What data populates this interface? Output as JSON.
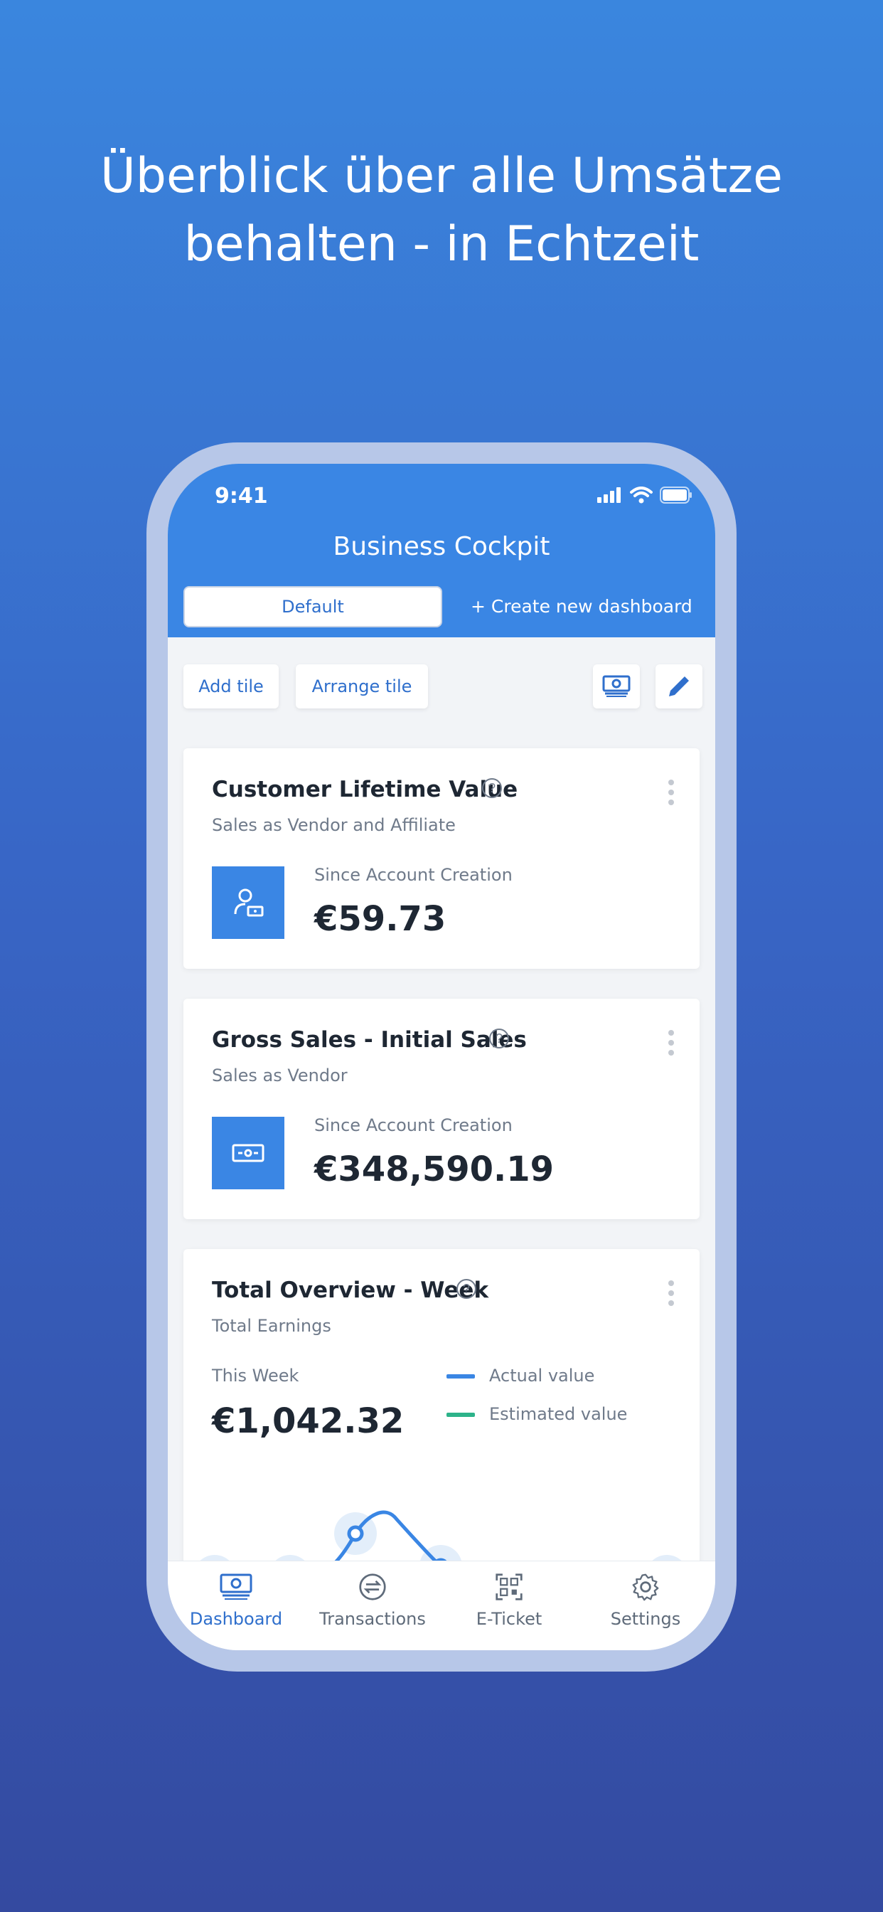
{
  "headline": {
    "line1": "Überblick über alle  Umsätze",
    "line2": "behalten - in Echtzeit"
  },
  "status_bar": {
    "time": "9:41"
  },
  "app": {
    "title": "Business Cockpit",
    "tabs": [
      {
        "label": "Default"
      },
      {
        "label": "+ Create new dashboard"
      }
    ]
  },
  "toolbar": {
    "add_tile": "Add tile",
    "arrange_tile": "Arrange tile",
    "icons": [
      "money-icon",
      "pencil-icon"
    ]
  },
  "cards": [
    {
      "title": "Customer Lifetime Value",
      "subtitle": "Sales as Vendor and Affiliate",
      "metric_label": "Since Account Creation",
      "metric_value": "€59.73",
      "icon": "customer-money-icon"
    },
    {
      "title": "Gross Sales - Initial Sales",
      "subtitle": "Sales as Vendor",
      "metric_label": "Since Account Creation",
      "metric_value": "€348,590.19",
      "icon": "banknote-icon"
    },
    {
      "title": "Total Overview - Week",
      "subtitle": "Total Earnings",
      "metric_label": "This Week",
      "metric_value": "€1,042.32",
      "legend": [
        {
          "label": "Actual value",
          "color": "#3A86E4"
        },
        {
          "label": "Estimated value",
          "color": "#2DB38A"
        }
      ]
    }
  ],
  "bottom_nav": {
    "items": [
      {
        "label": "Dashboard",
        "icon": "money-icon",
        "active": true
      },
      {
        "label": "Transactions",
        "icon": "transfer-icon",
        "active": false
      },
      {
        "label": "E-Ticket",
        "icon": "qr-code-icon",
        "active": false
      },
      {
        "label": "Settings",
        "icon": "gear-icon",
        "active": false
      }
    ]
  },
  "colors": {
    "accent": "#3A86E4",
    "nav_active": "#2F6FCC",
    "nav_inactive": "#5F6B7A",
    "estimated": "#2DB38A"
  }
}
